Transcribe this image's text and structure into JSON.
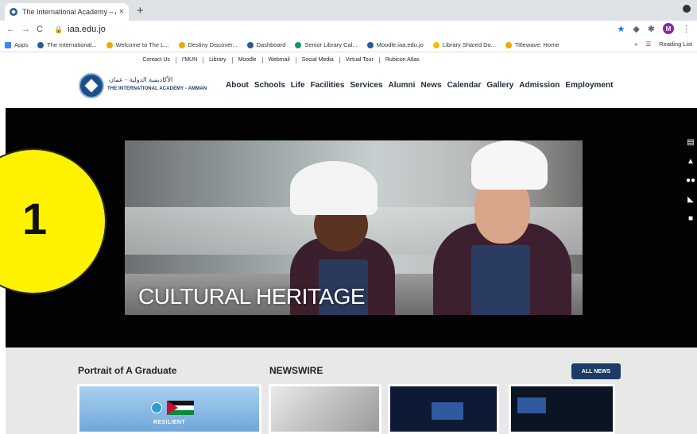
{
  "browser": {
    "tab_title": "The International Academy – A",
    "tab_close": "×",
    "new_tab": "+",
    "url": "iaa.edu.jo",
    "profile_initial": "M",
    "bookmarks": [
      {
        "label": "Apps",
        "color": "#4285f4"
      },
      {
        "label": "The International...",
        "color": "#2a5c9a"
      },
      {
        "label": "Welcome to The L...",
        "color": "#f2a600"
      },
      {
        "label": "Destiny Discover...",
        "color": "#f2a600"
      },
      {
        "label": "Dashboard",
        "color": "#2a5c9a"
      },
      {
        "label": "Senior Library Cal...",
        "color": "#0f9d58"
      },
      {
        "label": "Moodle.iaa.edu.jo",
        "color": "#2a5c9a"
      },
      {
        "label": "Library Shared Do...",
        "color": "#fbbc04"
      },
      {
        "label": "Titlewave: Home",
        "color": "#f2a600"
      }
    ],
    "bookmarks_more": "»",
    "reading_list": "Reading List"
  },
  "site": {
    "utility_links": [
      "Contact Us",
      "I'MUN",
      "Library",
      "Moodle",
      "Webmail",
      "Social Media",
      "Virtual Tour",
      "Rubicon Atlas"
    ],
    "logo_arabic": "الأكاديمية الدولية - عمان",
    "logo_english": "THE INTERNATIONAL ACADEMY - AMMAN",
    "nav": [
      "About",
      "Schools",
      "Life",
      "Facilities",
      "Services",
      "Alumni",
      "News",
      "Calendar",
      "Gallery",
      "Admission",
      "Employment"
    ],
    "hero_caption": "CULTURAL HERITAGE",
    "badge_number": "1",
    "portrait_title": "Portrait of A Graduate",
    "portrait_card_label": "RESILIENT",
    "newswire_title": "NEWSWIRE",
    "all_news_label": "ALL NEWS"
  }
}
